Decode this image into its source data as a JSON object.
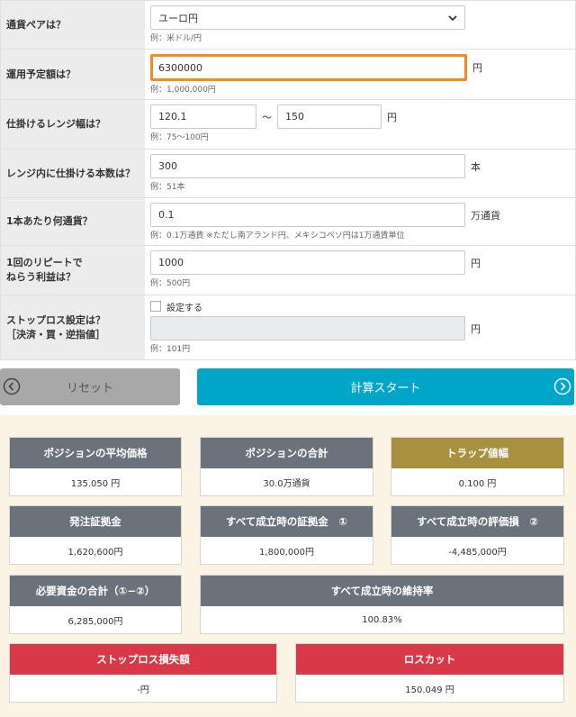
{
  "form": {
    "pair": {
      "label": "通貨ペアは？",
      "value": "ユーロ円",
      "hint": "例：米ドル/円"
    },
    "amount": {
      "label": "運用予定額は？",
      "value": "6300000",
      "unit": "円",
      "hint": "例：1,000,000円"
    },
    "range": {
      "label": "仕掛けるレンジ幅は？",
      "low": "120.1",
      "sep": "〜",
      "high": "150",
      "unit": "円",
      "hint": "例：75〜100円"
    },
    "count": {
      "label": "レンジ内に仕掛ける本数は？",
      "value": "300",
      "unit": "本",
      "hint": "例：51本"
    },
    "lot": {
      "label": "1本あたり何通貨？",
      "value": "0.1",
      "unit": "万通貨",
      "hint": "例：0.1万通貨 ※ただし南アランド円、メキシコペソ円は1万通貨単位"
    },
    "profit": {
      "label_line1": "1回のリピートで",
      "label_line2": "ねらう利益は？",
      "value": "1000",
      "unit": "円",
      "hint": "例：500円"
    },
    "stoploss": {
      "label_line1": "ストップロス設定は？",
      "label_line2": "［決済・買・逆指値］",
      "checkbox_label": "設定する",
      "value": "",
      "unit": "円",
      "hint": "例：101円"
    }
  },
  "buttons": {
    "reset": "リセット",
    "start": "計算スタート"
  },
  "results": {
    "avg_price": {
      "title": "ポジションの平均価格",
      "value": "135.050 円"
    },
    "total_position": {
      "title": "ポジションの合計",
      "value": "30.0万通貨"
    },
    "trap_width": {
      "title": "トラップ値幅",
      "value": "0.100 円"
    },
    "order_margin": {
      "title": "発注証拠金",
      "value": "1,620,600円"
    },
    "full_margin": {
      "title": "すべて成立時の証拠金　①",
      "value": "1,800,000円"
    },
    "full_loss": {
      "title": "すべて成立時の評価損　②",
      "value": "-4,485,000円"
    },
    "required": {
      "title": "必要資金の合計（①−②）",
      "value": "6,285,000円"
    },
    "maintenance": {
      "title": "すべて成立時の維持率",
      "value": "100.83%"
    },
    "stoploss_loss": {
      "title": "ストップロス損失額",
      "value": "-円"
    },
    "losscut": {
      "title": "ロスカット",
      "value": "150.049 円"
    }
  },
  "colors": {
    "accent": "#00a6c8",
    "focus": "#f28c1e",
    "header_gray": "#6a727c",
    "header_gold": "#a8903f",
    "header_red": "#d93848"
  }
}
